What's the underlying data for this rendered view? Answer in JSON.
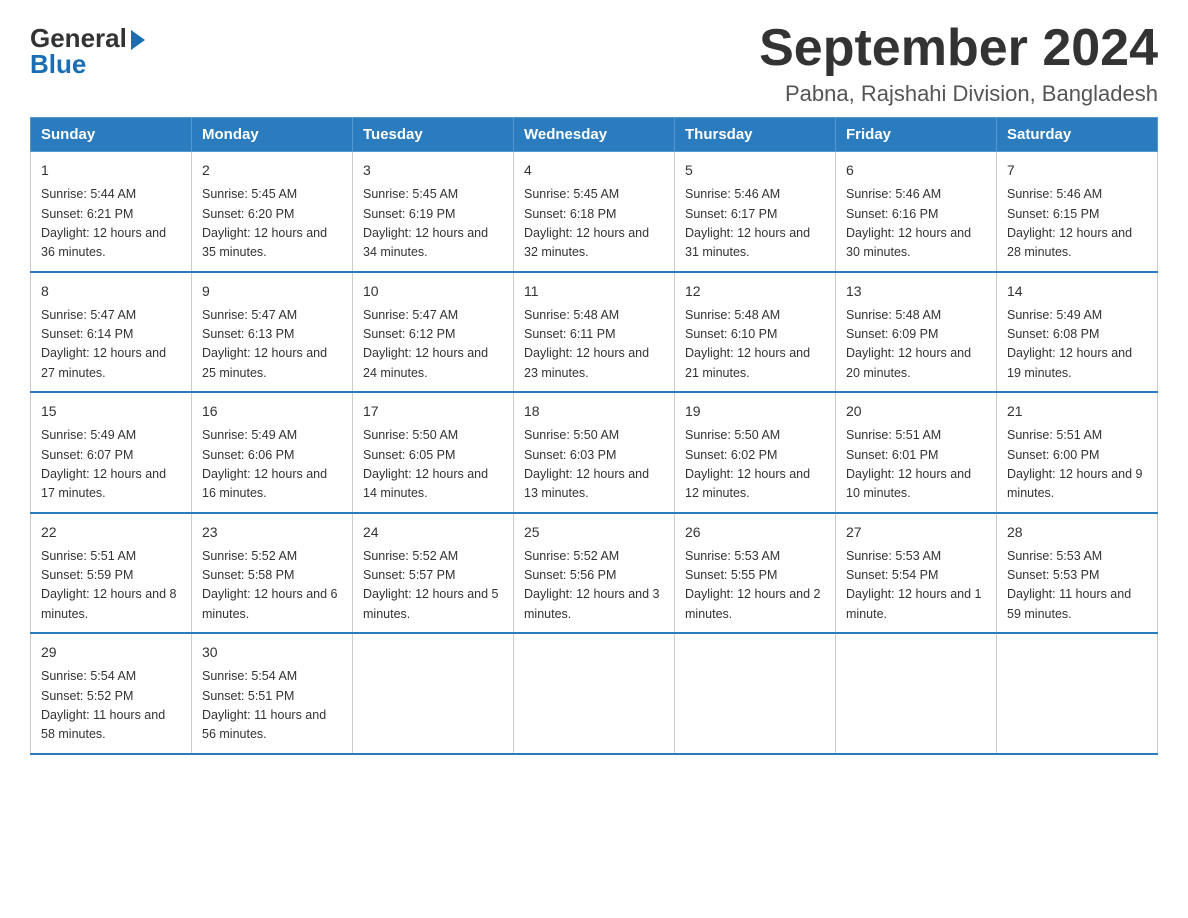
{
  "logo": {
    "general": "General",
    "blue": "Blue"
  },
  "title": {
    "month_year": "September 2024",
    "location": "Pabna, Rajshahi Division, Bangladesh"
  },
  "weekdays": [
    "Sunday",
    "Monday",
    "Tuesday",
    "Wednesday",
    "Thursday",
    "Friday",
    "Saturday"
  ],
  "weeks": [
    [
      {
        "day": "1",
        "sunrise": "5:44 AM",
        "sunset": "6:21 PM",
        "daylight": "12 hours and 36 minutes."
      },
      {
        "day": "2",
        "sunrise": "5:45 AM",
        "sunset": "6:20 PM",
        "daylight": "12 hours and 35 minutes."
      },
      {
        "day": "3",
        "sunrise": "5:45 AM",
        "sunset": "6:19 PM",
        "daylight": "12 hours and 34 minutes."
      },
      {
        "day": "4",
        "sunrise": "5:45 AM",
        "sunset": "6:18 PM",
        "daylight": "12 hours and 32 minutes."
      },
      {
        "day": "5",
        "sunrise": "5:46 AM",
        "sunset": "6:17 PM",
        "daylight": "12 hours and 31 minutes."
      },
      {
        "day": "6",
        "sunrise": "5:46 AM",
        "sunset": "6:16 PM",
        "daylight": "12 hours and 30 minutes."
      },
      {
        "day": "7",
        "sunrise": "5:46 AM",
        "sunset": "6:15 PM",
        "daylight": "12 hours and 28 minutes."
      }
    ],
    [
      {
        "day": "8",
        "sunrise": "5:47 AM",
        "sunset": "6:14 PM",
        "daylight": "12 hours and 27 minutes."
      },
      {
        "day": "9",
        "sunrise": "5:47 AM",
        "sunset": "6:13 PM",
        "daylight": "12 hours and 25 minutes."
      },
      {
        "day": "10",
        "sunrise": "5:47 AM",
        "sunset": "6:12 PM",
        "daylight": "12 hours and 24 minutes."
      },
      {
        "day": "11",
        "sunrise": "5:48 AM",
        "sunset": "6:11 PM",
        "daylight": "12 hours and 23 minutes."
      },
      {
        "day": "12",
        "sunrise": "5:48 AM",
        "sunset": "6:10 PM",
        "daylight": "12 hours and 21 minutes."
      },
      {
        "day": "13",
        "sunrise": "5:48 AM",
        "sunset": "6:09 PM",
        "daylight": "12 hours and 20 minutes."
      },
      {
        "day": "14",
        "sunrise": "5:49 AM",
        "sunset": "6:08 PM",
        "daylight": "12 hours and 19 minutes."
      }
    ],
    [
      {
        "day": "15",
        "sunrise": "5:49 AM",
        "sunset": "6:07 PM",
        "daylight": "12 hours and 17 minutes."
      },
      {
        "day": "16",
        "sunrise": "5:49 AM",
        "sunset": "6:06 PM",
        "daylight": "12 hours and 16 minutes."
      },
      {
        "day": "17",
        "sunrise": "5:50 AM",
        "sunset": "6:05 PM",
        "daylight": "12 hours and 14 minutes."
      },
      {
        "day": "18",
        "sunrise": "5:50 AM",
        "sunset": "6:03 PM",
        "daylight": "12 hours and 13 minutes."
      },
      {
        "day": "19",
        "sunrise": "5:50 AM",
        "sunset": "6:02 PM",
        "daylight": "12 hours and 12 minutes."
      },
      {
        "day": "20",
        "sunrise": "5:51 AM",
        "sunset": "6:01 PM",
        "daylight": "12 hours and 10 minutes."
      },
      {
        "day": "21",
        "sunrise": "5:51 AM",
        "sunset": "6:00 PM",
        "daylight": "12 hours and 9 minutes."
      }
    ],
    [
      {
        "day": "22",
        "sunrise": "5:51 AM",
        "sunset": "5:59 PM",
        "daylight": "12 hours and 8 minutes."
      },
      {
        "day": "23",
        "sunrise": "5:52 AM",
        "sunset": "5:58 PM",
        "daylight": "12 hours and 6 minutes."
      },
      {
        "day": "24",
        "sunrise": "5:52 AM",
        "sunset": "5:57 PM",
        "daylight": "12 hours and 5 minutes."
      },
      {
        "day": "25",
        "sunrise": "5:52 AM",
        "sunset": "5:56 PM",
        "daylight": "12 hours and 3 minutes."
      },
      {
        "day": "26",
        "sunrise": "5:53 AM",
        "sunset": "5:55 PM",
        "daylight": "12 hours and 2 minutes."
      },
      {
        "day": "27",
        "sunrise": "5:53 AM",
        "sunset": "5:54 PM",
        "daylight": "12 hours and 1 minute."
      },
      {
        "day": "28",
        "sunrise": "5:53 AM",
        "sunset": "5:53 PM",
        "daylight": "11 hours and 59 minutes."
      }
    ],
    [
      {
        "day": "29",
        "sunrise": "5:54 AM",
        "sunset": "5:52 PM",
        "daylight": "11 hours and 58 minutes."
      },
      {
        "day": "30",
        "sunrise": "5:54 AM",
        "sunset": "5:51 PM",
        "daylight": "11 hours and 56 minutes."
      },
      null,
      null,
      null,
      null,
      null
    ]
  ],
  "labels": {
    "sunrise": "Sunrise:",
    "sunset": "Sunset:",
    "daylight": "Daylight:"
  }
}
